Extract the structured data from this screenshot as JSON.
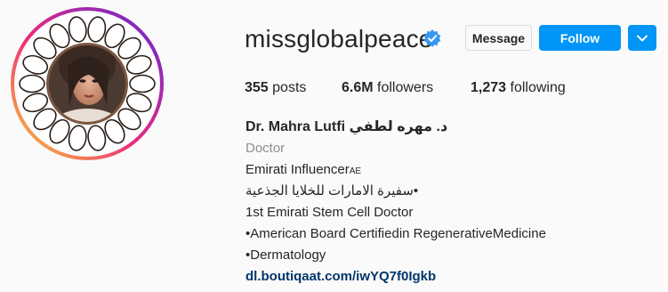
{
  "profile": {
    "username": "missglobalpeace",
    "verified": true,
    "message_label": "Message",
    "follow_label": "Follow",
    "stats": {
      "posts_value": "355",
      "posts_label": "posts",
      "followers_value": "6.6M",
      "followers_label": "followers",
      "following_value": "1,273",
      "following_label": "following"
    },
    "full_name": "Dr. Mahra Lutfi د. مهره لطفي",
    "category": "Doctor",
    "bio": {
      "line1_main": "Emirati Influencer",
      "line1_suffix": "AE",
      "line2": "سفيرة الامارات للخلايا الجذعية•",
      "line3": "1st Emirati Stem Cell Doctor",
      "line4": "•American Board Certifiedin RegenerativeMedicine",
      "line5": "•Dermatology"
    },
    "link": "dl.boutiqaat.com/iwYQ7f0Igkb"
  },
  "colors": {
    "accent": "#0095f6",
    "link": "#00376b",
    "muted": "#8e8e8e",
    "verified_badge": "#3897f0"
  },
  "icons": {
    "verified": "verified-badge-icon",
    "dropdown": "chevron-down-icon"
  }
}
